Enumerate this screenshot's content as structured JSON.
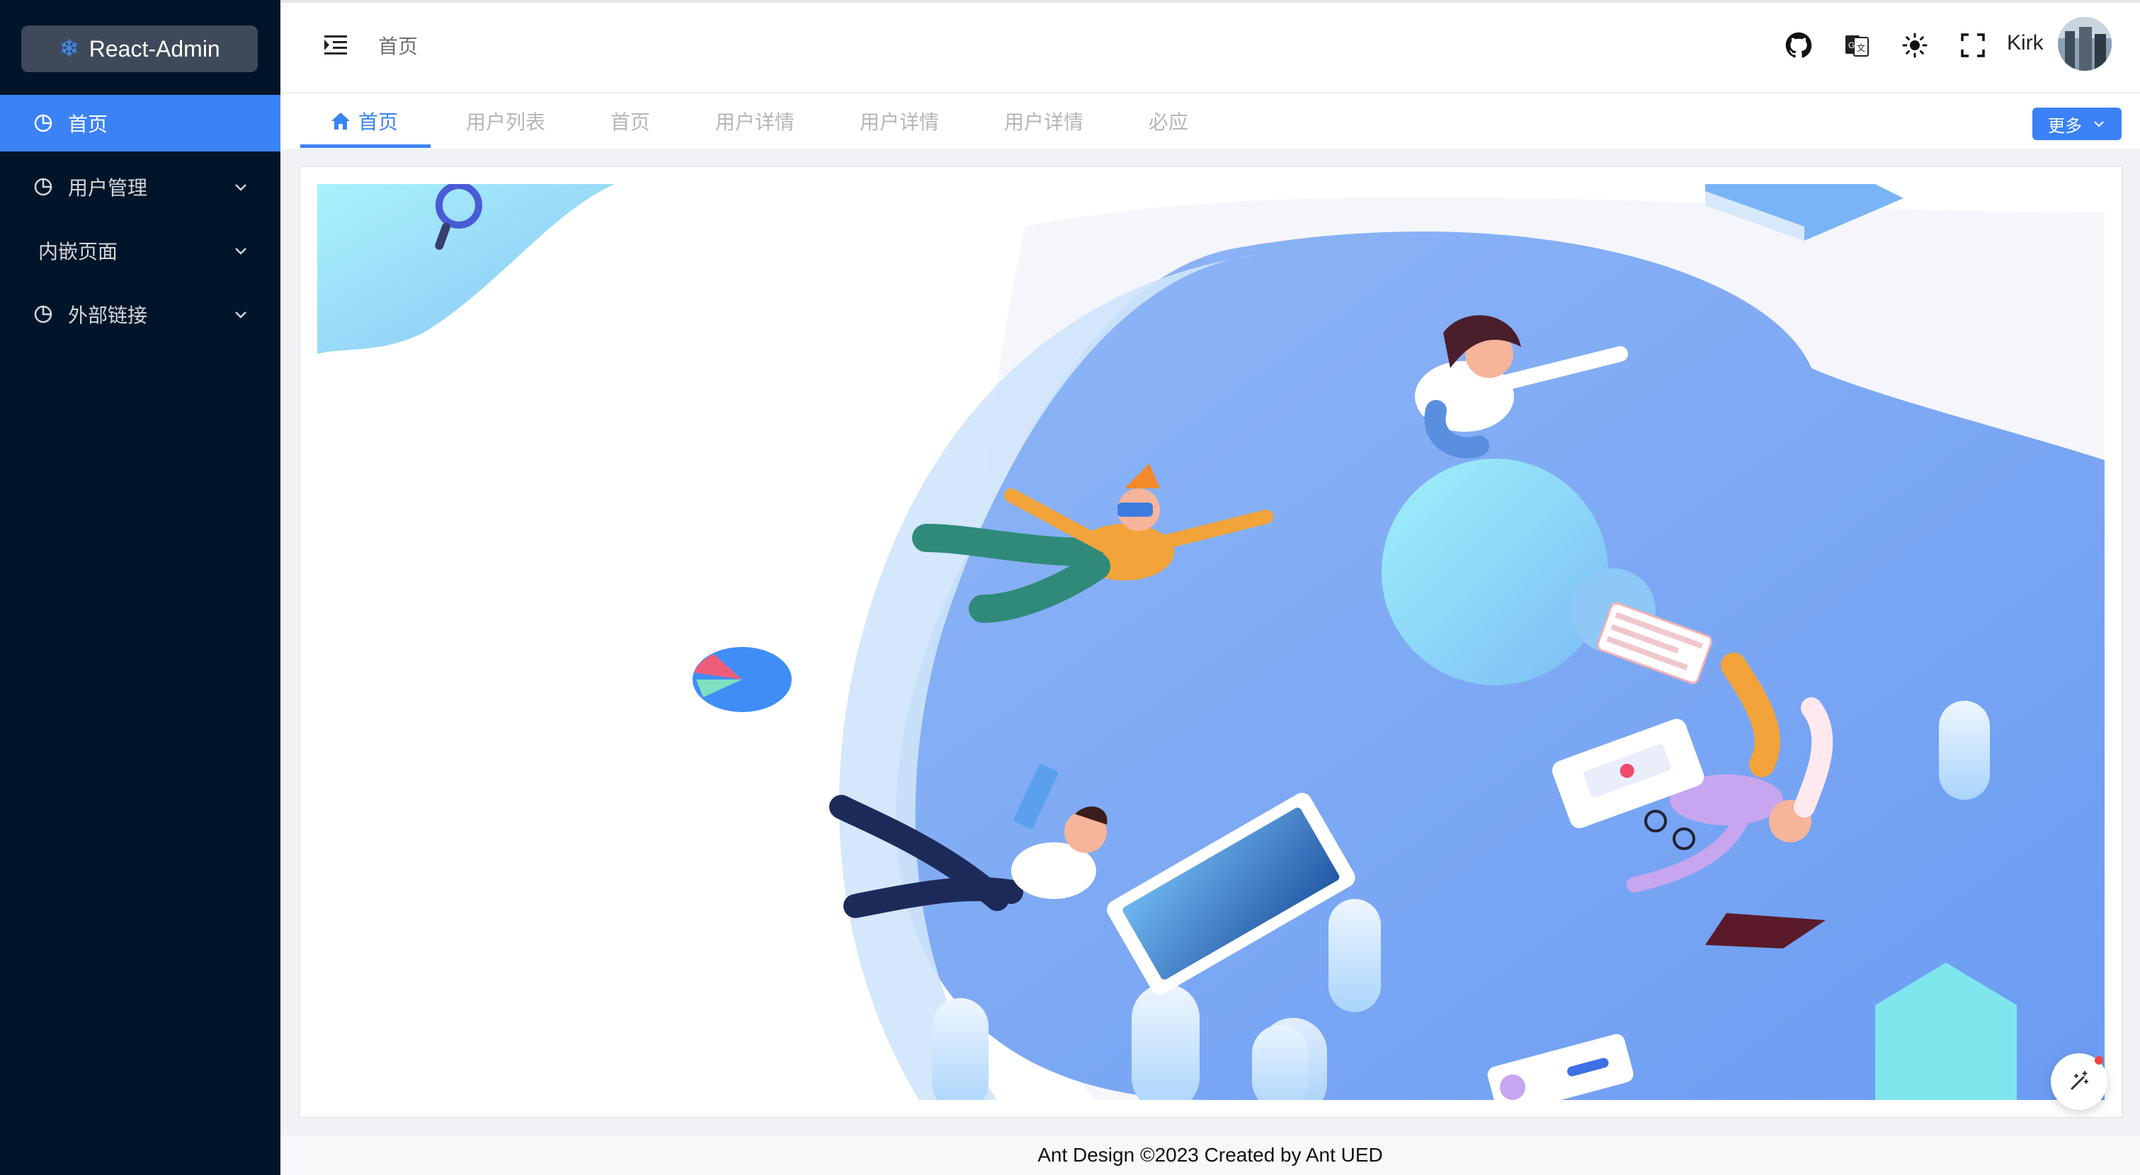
{
  "app": {
    "logo_text": "React-Admin",
    "logo_icon": "snowflake-icon"
  },
  "sidebar": {
    "items": [
      {
        "label": "首页",
        "icon": "pie-chart-icon",
        "active": true
      },
      {
        "label": "用户管理",
        "icon": "pie-chart-icon",
        "expandable": true
      },
      {
        "label": "内嵌页面",
        "icon": "",
        "expandable": true
      },
      {
        "label": "外部链接",
        "icon": "pie-chart-icon",
        "expandable": true
      }
    ]
  },
  "header": {
    "breadcrumb": "首页",
    "icons": [
      "menu-fold-icon",
      "github-icon",
      "translate-icon",
      "sun-icon",
      "fullscreen-icon"
    ],
    "username": "Kirk"
  },
  "tabs": {
    "items": [
      {
        "label": "首页",
        "icon": "home-icon",
        "active": true
      },
      {
        "label": "用户列表"
      },
      {
        "label": "首页"
      },
      {
        "label": "用户详情"
      },
      {
        "label": "用户详情"
      },
      {
        "label": "用户详情"
      },
      {
        "label": "必应"
      }
    ],
    "more_label": "更多"
  },
  "footer": {
    "text": "Ant Design ©2023 Created by Ant UED"
  },
  "colors": {
    "sidebar_bg": "#001529",
    "accent": "#3b82f6",
    "page_bg": "#f0f2f5"
  }
}
